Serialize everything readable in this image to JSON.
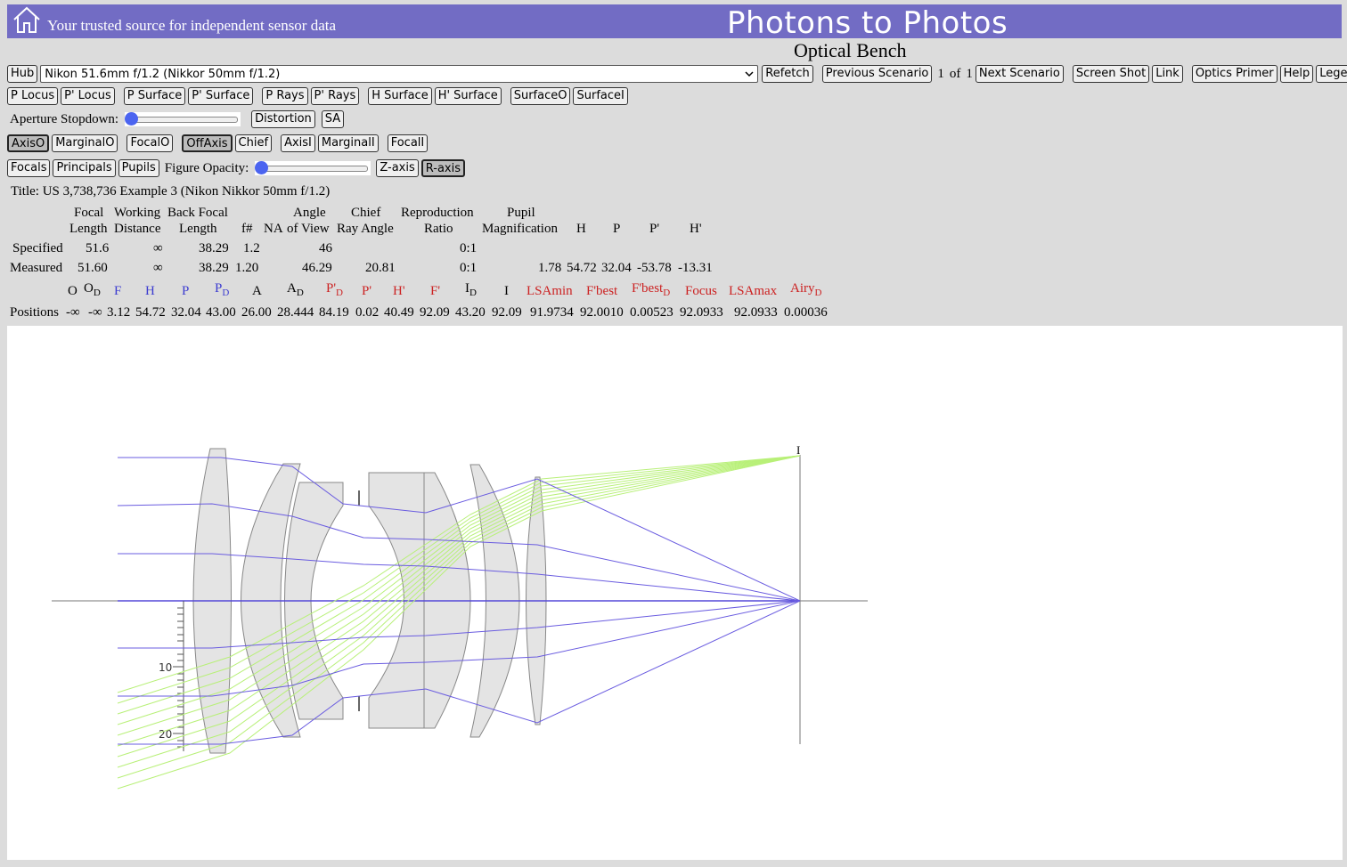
{
  "header": {
    "tagline": "Your trusted source for independent sensor data",
    "site_title": "Photons to Photos",
    "page_title": "Optical Bench"
  },
  "toolbar": {
    "hub": "Hub",
    "lens_select": "Nikon 51.6mm f/1.2 (Nikkor 50mm f/1.2)",
    "refetch": "Refetch",
    "previous_scenario": "Previous Scenario",
    "scenario_current": "1",
    "scenario_of": "of",
    "scenario_total": "1",
    "next_scenario": "Next Scenario",
    "screen_shot": "Screen Shot",
    "link": "Link",
    "optics_primer": "Optics Primer",
    "help": "Help",
    "legend": "Legend"
  },
  "row2": [
    "P Locus",
    "P' Locus",
    "P Surface",
    "P' Surface",
    "P Rays",
    "P' Rays",
    "H Surface",
    "H' Surface",
    "SurfaceO",
    "SurfaceI"
  ],
  "row3": {
    "aperture_label": "Aperture Stopdown:",
    "aperture_value": 0,
    "distortion": "Distortion",
    "sa": "SA"
  },
  "row4": [
    "AxisO",
    "MarginalO",
    "FocalO",
    "OffAxis",
    "Chief",
    "AxisI",
    "MarginalI",
    "FocalI"
  ],
  "row5": {
    "focals": "Focals",
    "principals": "Principals",
    "pupils": "Pupils",
    "opacity_label": "Figure Opacity:",
    "opacity_value": 0,
    "z_axis": "Z-axis",
    "r_axis": "R-axis"
  },
  "info": {
    "title": "Title: US 3,738,736 Example 3 (Nikon Nikkor 50mm f/1.2)",
    "headers": {
      "focal": [
        "Focal",
        "Length"
      ],
      "working": [
        "Working",
        "Distance"
      ],
      "back": [
        "Back Focal",
        "Length"
      ],
      "fnum": "f#",
      "na": "NA",
      "angle": [
        "Angle",
        "of View"
      ],
      "chief": [
        "Chief",
        "Ray Angle"
      ],
      "repro": [
        "Reproduction",
        "Ratio"
      ],
      "pupil": [
        "Pupil",
        "Magnification"
      ],
      "h": "H",
      "p": "P",
      "pp": "P'",
      "hp": "H'"
    },
    "specified": {
      "label": "Specified",
      "focal": "51.6",
      "working": "∞",
      "back": "38.29",
      "fnum": "1.2",
      "angle": "46",
      "repro": "0:1"
    },
    "measured": {
      "label": "Measured",
      "focal": "51.60",
      "working": "∞",
      "back": "38.29",
      "fnum": "1.20",
      "angle": "46.29",
      "chief": "20.81",
      "repro": "0:1",
      "pupil": "1.78",
      "h": "54.72",
      "p": "32.04",
      "pp": "-53.78",
      "hp": "-13.31"
    }
  },
  "positions": {
    "label": "Positions",
    "symbols": [
      "O",
      "O",
      "F",
      "H",
      "P",
      "P",
      "A",
      "A",
      "P'",
      "P'",
      "H'",
      "F'",
      "I",
      "I",
      "LSAmin",
      "F'best",
      "F'best",
      "Focus",
      "LSAmax",
      "Airy"
    ],
    "subscript": "D",
    "values": [
      "-∞",
      "-∞",
      "3.12",
      "54.72",
      "32.04",
      "43.00",
      "26.00",
      "28.444",
      "84.19",
      "0.02",
      "40.49",
      "92.09",
      "43.20",
      "92.09",
      "91.9734",
      "92.0010",
      "0.00523",
      "92.0933",
      "92.0933",
      "0.00036"
    ]
  },
  "diagram": {
    "image_label": "I",
    "ticks": [
      "10",
      "20"
    ]
  },
  "colors": {
    "banner": "#726cc4",
    "axis_ray": "#6a5ce0",
    "offaxis_ray": "#b8f078",
    "symbol_blue": "#3b3bd0",
    "symbol_red": "#cc2222"
  }
}
